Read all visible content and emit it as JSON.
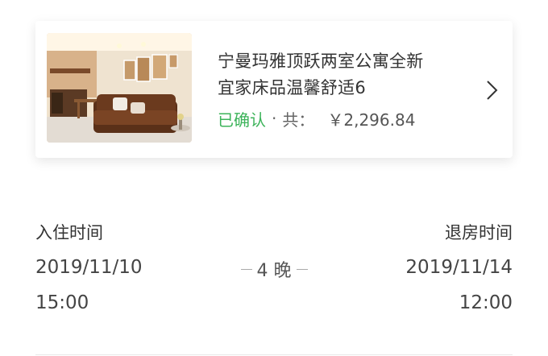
{
  "listing": {
    "title_line1": "宁曼玛雅顶跃两室公寓全新",
    "title_line2": "宜家床品温馨舒适6",
    "status": "已确认",
    "separator": "·",
    "total_label": "共：",
    "price": "￥2,296.84",
    "chevron_icon": "chevron-right-icon",
    "photo": "living-room-photo"
  },
  "stay": {
    "checkin_label": "入住时间",
    "checkin_date": "2019/11/10",
    "checkin_time": "15:00",
    "nights": "4 晚",
    "checkout_label": "退房时间",
    "checkout_date": "2019/11/14",
    "checkout_time": "12:00"
  },
  "colors": {
    "status_green": "#3cb35a",
    "text": "#333333"
  }
}
